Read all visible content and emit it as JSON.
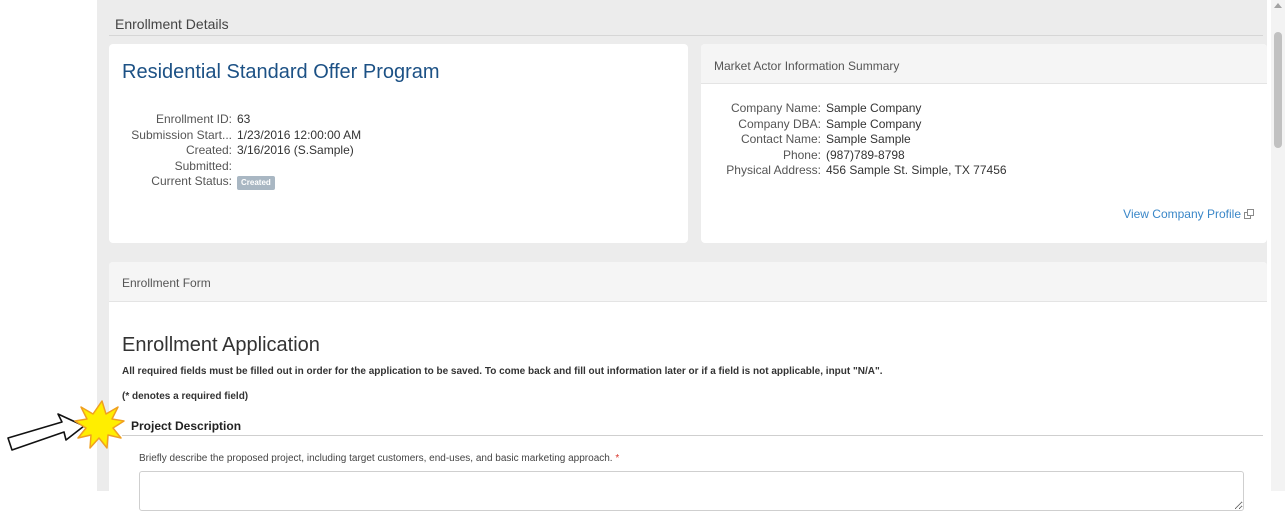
{
  "header": {
    "title": "Enrollment Details"
  },
  "program": {
    "title": "Residential Standard Offer Program",
    "fields": [
      {
        "label": "Enrollment ID:",
        "value": "63"
      },
      {
        "label": "Submission Start...",
        "value": "1/23/2016 12:00:00 AM"
      },
      {
        "label": "Created:",
        "value": "3/16/2016 (S.Sample)"
      },
      {
        "label": "Submitted:",
        "value": ""
      }
    ],
    "status": {
      "label": "Current Status:",
      "badge": "Created"
    }
  },
  "market_actor": {
    "title": "Market Actor Information Summary",
    "fields": [
      {
        "label": "Company Name:",
        "value": "Sample Company"
      },
      {
        "label": "Company DBA:",
        "value": "Sample Company"
      },
      {
        "label": "Contact Name:",
        "value": "Sample Sample"
      },
      {
        "label": "Phone:",
        "value": "(987)789-8798"
      },
      {
        "label": "Physical Address:",
        "value": "456 Sample St. Simple, TX 77456"
      }
    ],
    "view_profile": "View Company Profile"
  },
  "form": {
    "header": "Enrollment Form",
    "title": "Enrollment Application",
    "instructions": "All required fields must be filled out in order for the application to be saved. To come back and fill out information later or if a field is not applicable, input \"N/A\".",
    "required_note": "(* denotes a required field)",
    "section_title": "Project Description",
    "field_label": "Briefly describe the proposed project, including target customers, end-uses, and basic marketing approach.",
    "required_marker": "*"
  },
  "colors": {
    "title_blue": "#1c5185",
    "link_blue": "#3a87c8",
    "badge_gray": "#a9b7c3",
    "required_red": "#d9342b",
    "callout_yellow": "#ffee00"
  },
  "icons": {
    "external_link": "external-link-icon",
    "callout": "starburst-arrow-icon"
  }
}
